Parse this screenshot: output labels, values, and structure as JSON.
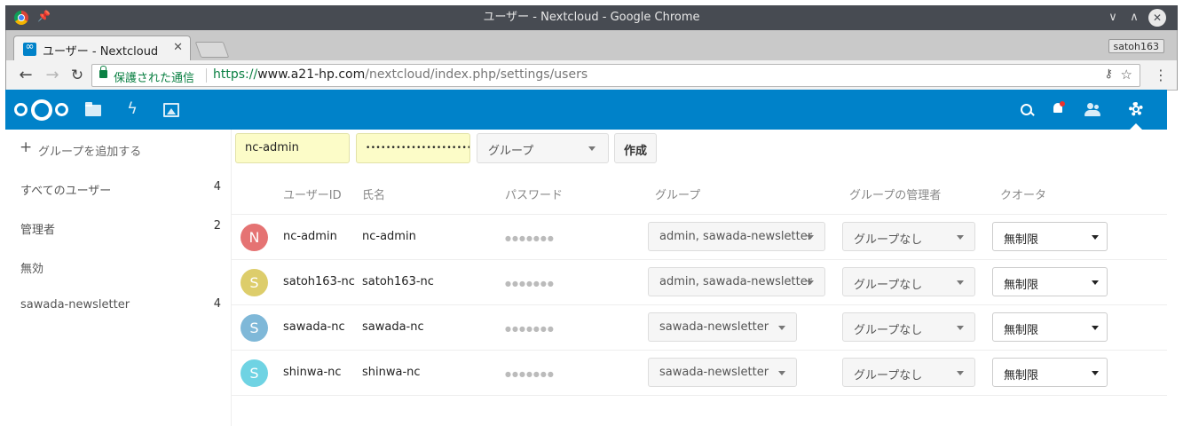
{
  "browser": {
    "window_title": "ユーザー - Nextcloud - Google Chrome",
    "tab_title": "ユーザー - Nextcloud",
    "profile": "satoh163",
    "secure_label": "保護された通信",
    "url_scheme": "https://",
    "url_host": "www.a21-hp.com",
    "url_path": "/nextcloud/index.php/settings/users"
  },
  "sidebar": {
    "add_group": "グループを追加する",
    "items": [
      {
        "label": "すべてのユーザー",
        "count": "4"
      },
      {
        "label": "管理者",
        "count": "2"
      },
      {
        "label": "無効",
        "count": ""
      },
      {
        "label": "sawada-newsletter",
        "count": "4"
      }
    ]
  },
  "new_user": {
    "username": "nc-admin",
    "password_mask": "••••••••••••••••••••••••••",
    "group_placeholder": "グループ",
    "create_label": "作成"
  },
  "columns": {
    "userid": "ユーザーID",
    "display_name": "氏名",
    "password": "パスワード",
    "groups": "グループ",
    "subadmin": "グループの管理者",
    "quota": "クオータ"
  },
  "users": [
    {
      "initial": "N",
      "avatar_color": "#e57373",
      "id": "nc-admin",
      "name": "nc-admin",
      "pw": "●●●●●●●",
      "groups": "admin, sawada-newsletter",
      "subadmin": "グループなし",
      "quota": "無制限"
    },
    {
      "initial": "S",
      "avatar_color": "#ddcd6b",
      "id": "satoh163-nc",
      "name": "satoh163-nc",
      "pw": "●●●●●●●",
      "groups": "admin, sawada-newsletter",
      "subadmin": "グループなし",
      "quota": "無制限"
    },
    {
      "initial": "S",
      "avatar_color": "#7fb8d8",
      "id": "sawada-nc",
      "name": "sawada-nc",
      "pw": "●●●●●●●",
      "groups": "sawada-newsletter",
      "subadmin": "グループなし",
      "quota": "無制限"
    },
    {
      "initial": "S",
      "avatar_color": "#6fd3e3",
      "id": "shinwa-nc",
      "name": "shinwa-nc",
      "pw": "●●●●●●●",
      "groups": "sawada-newsletter",
      "subadmin": "グループなし",
      "quota": "無制限"
    }
  ],
  "colors": {
    "nextcloud_blue": "#0082c9",
    "input_highlight": "#fcfcc8"
  }
}
